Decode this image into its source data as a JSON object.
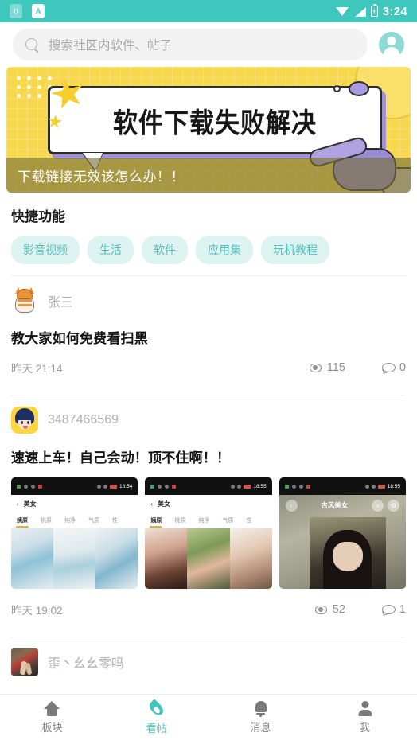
{
  "status_bar": {
    "time": "3:24",
    "left_icons": [
      "app-icon-battery-saver",
      "app-icon-a"
    ],
    "right_icons": [
      "wifi-icon",
      "signal-icon",
      "battery-charging-icon"
    ],
    "background_color": "#3ec7bd"
  },
  "header": {
    "search_placeholder": "搜索社区内软件、帖子",
    "search_value": "",
    "profile_icon": "account-avatar-icon"
  },
  "banner": {
    "title": "软件下载失败解决",
    "caption": "下载链接无效该怎么办！！",
    "bg_color": "#f7d74e",
    "accent_color": "#a391d6"
  },
  "quick_functions": {
    "title": "快捷功能",
    "chips": [
      {
        "label": "影音视频"
      },
      {
        "label": "生活"
      },
      {
        "label": "软件"
      },
      {
        "label": "应用集"
      },
      {
        "label": "玩机教程"
      }
    ],
    "chip_bg": "#ddf3f1",
    "chip_text": "#55bdb8"
  },
  "posts": [
    {
      "avatar": "cat-avatar",
      "user": "张三",
      "title": "教大家如何免费看扫黑",
      "time": "昨天 21:14",
      "views": "115",
      "comments": "0"
    },
    {
      "avatar": "anime-avatar",
      "user": "3487466569",
      "title": "速速上车！自己会动！顶不住啊！！",
      "time": "昨天 19:02",
      "views": "52",
      "comments": "1",
      "thumbnails": [
        {
          "status_time": "18:54",
          "nav_title": "美女",
          "tabs": [
            "姨原",
            "桃原",
            "纯净",
            "气质",
            "性"
          ]
        },
        {
          "status_time": "18:55",
          "nav_title": "美女",
          "tabs": [
            "姨原",
            "桃原",
            "纯净",
            "气质",
            "性"
          ]
        },
        {
          "status_time": "18:55",
          "overlay_title": "古风美女"
        }
      ]
    },
    {
      "avatar": "photo-avatar",
      "user": "歪丶幺幺零吗"
    }
  ],
  "tabbar": {
    "items": [
      {
        "label": "板块",
        "icon": "home-icon",
        "active": false
      },
      {
        "label": "看帖",
        "icon": "flame-icon",
        "active": true
      },
      {
        "label": "消息",
        "icon": "bell-icon",
        "active": false
      },
      {
        "label": "我",
        "icon": "person-icon",
        "active": false
      }
    ],
    "active_color": "#3ec7bd",
    "inactive_color": "#858585"
  }
}
